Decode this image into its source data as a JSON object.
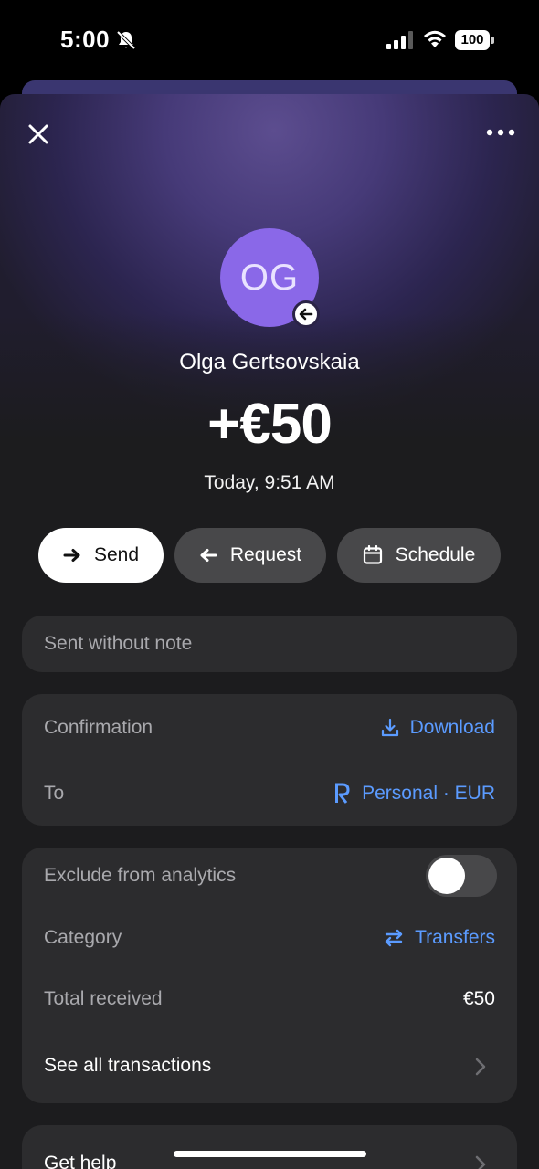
{
  "status_bar": {
    "time": "5:00",
    "battery": "100",
    "icons": [
      "bell-slash-icon",
      "signal-icon",
      "wifi-icon",
      "battery-icon"
    ]
  },
  "header": {
    "close_icon": "close-icon",
    "more_icon": "more-icon"
  },
  "transaction": {
    "avatar_initials": "OG",
    "avatar_color": "#8a68e8",
    "badge_icon": "arrow-left-icon",
    "contact_name": "Olga Gertsovskaia",
    "amount": "+€50",
    "timestamp": "Today, 9:51 AM"
  },
  "actions": [
    {
      "label": "Send",
      "icon": "arrow-right-icon"
    },
    {
      "label": "Request",
      "icon": "arrow-left-icon"
    },
    {
      "label": "Schedule",
      "icon": "calendar-icon"
    }
  ],
  "note": {
    "text": "Sent without note"
  },
  "details": {
    "confirmation_label": "Confirmation",
    "confirmation_value": "Download",
    "to_label": "To",
    "to_value": "Personal · EUR"
  },
  "analytics": {
    "exclude_label": "Exclude from analytics",
    "exclude_enabled": false,
    "category_label": "Category",
    "category_value": "Transfers",
    "total_label": "Total received",
    "total_value": "€50",
    "see_all_label": "See all transactions"
  },
  "help": {
    "label": "Get help"
  },
  "colors": {
    "accent_link": "#5b9bff",
    "card_bg": "#2c2c2e",
    "page_bg": "#1c1c1e"
  }
}
